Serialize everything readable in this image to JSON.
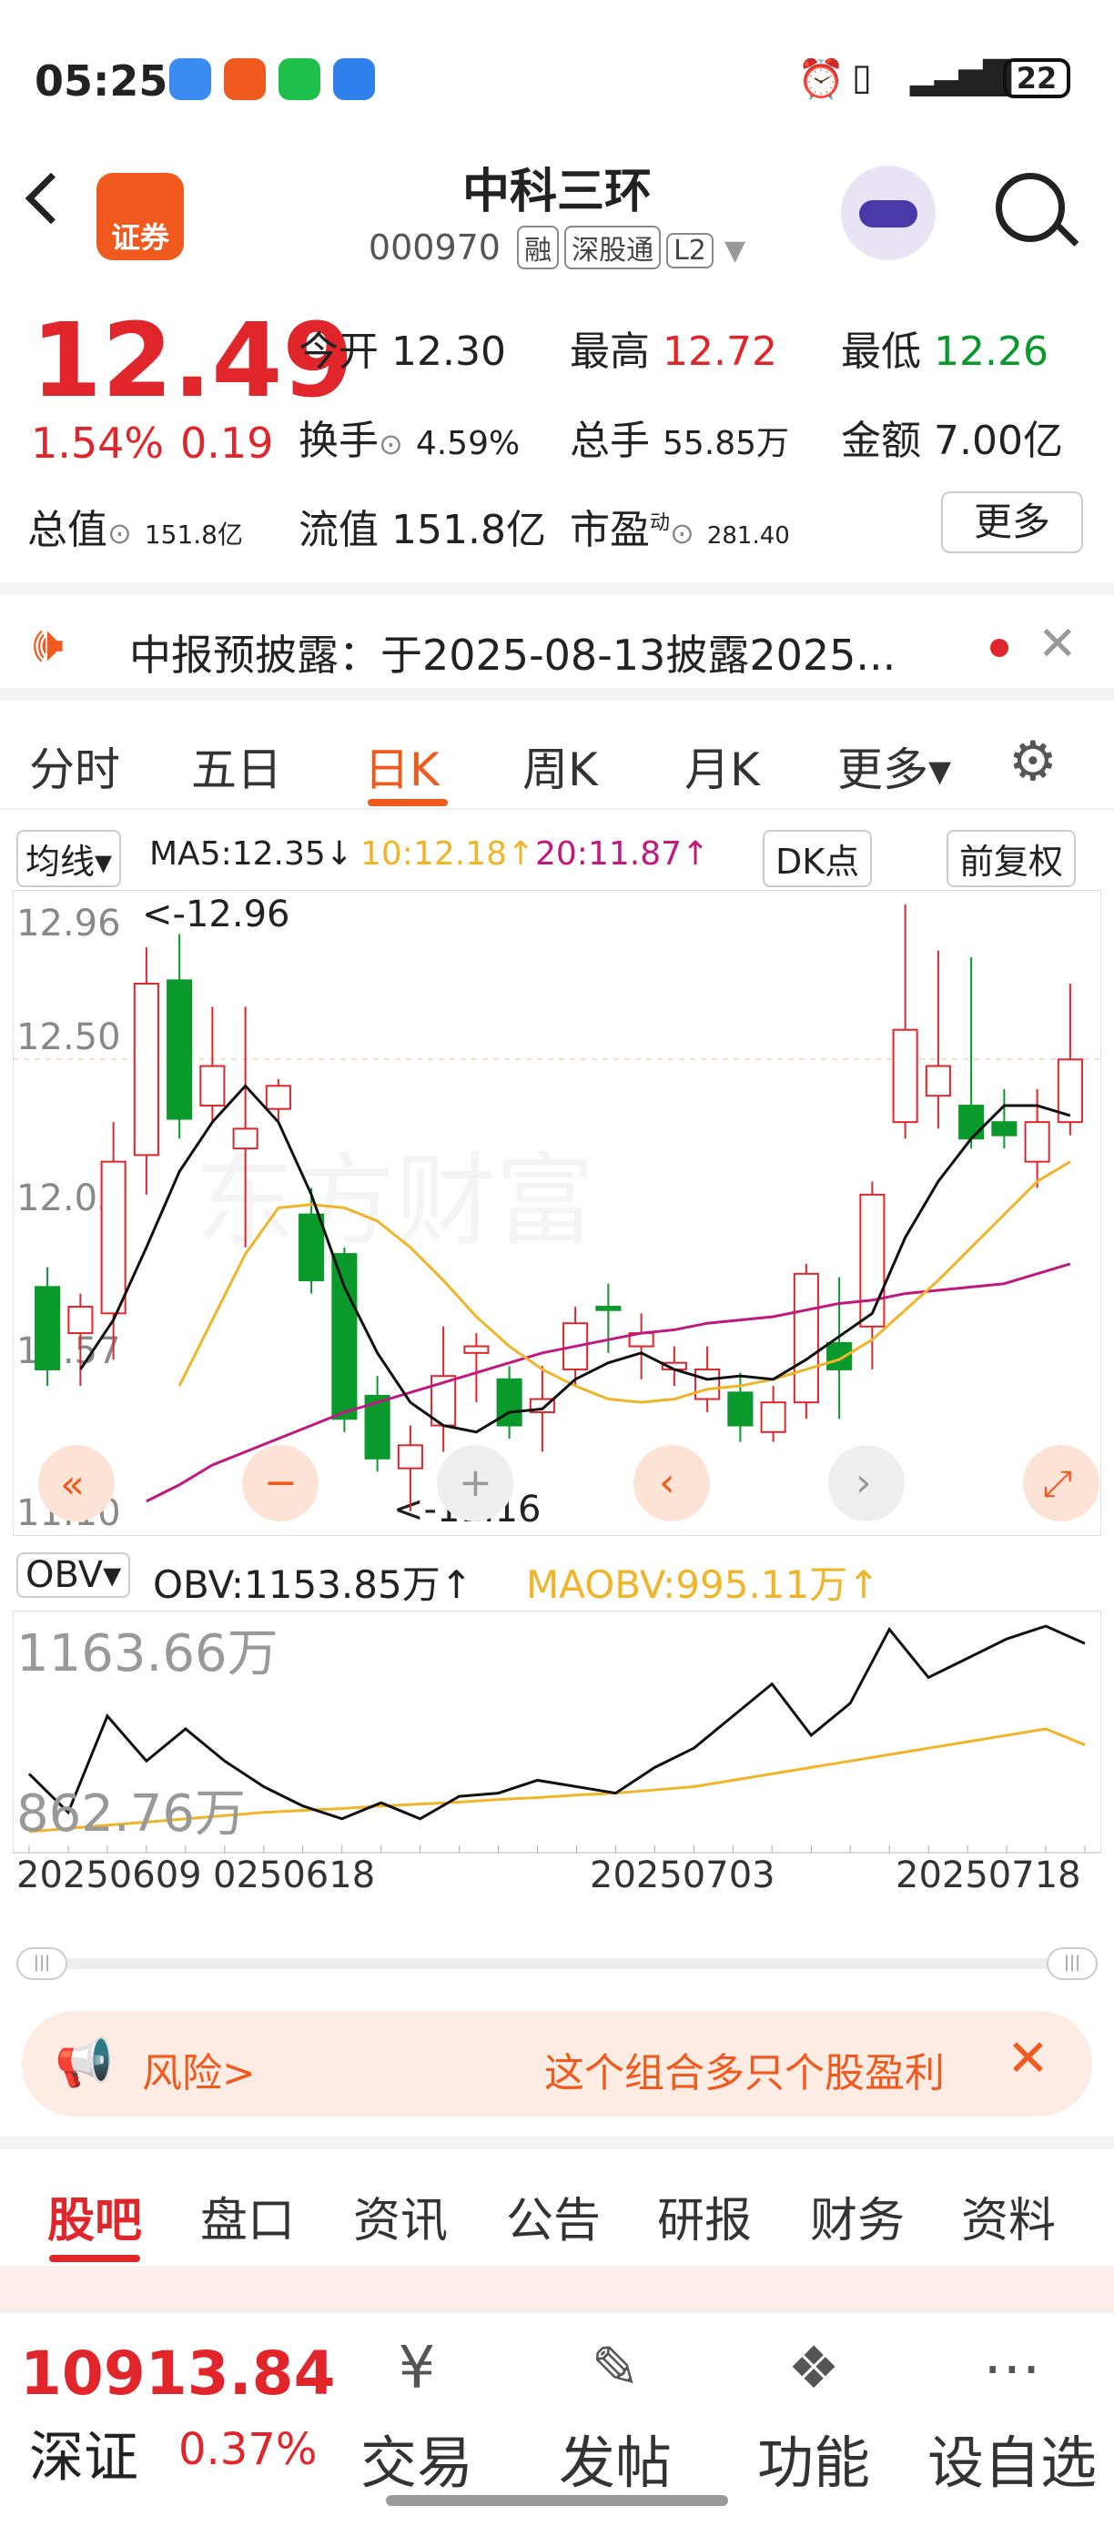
{
  "status": {
    "time": "05:25",
    "battery": "22"
  },
  "header": {
    "logo_label": "证券",
    "title": "中科三环",
    "code": "000970",
    "tags": [
      "融",
      "深股通",
      "L2"
    ]
  },
  "quote": {
    "price": "12.49",
    "change_pct": "1.54%",
    "change": "0.19",
    "open_label": "今开",
    "open": "12.30",
    "high_label": "最高",
    "high": "12.72",
    "low_label": "最低",
    "low": "12.26",
    "turnover_label": "换手",
    "turnover": "4.59%",
    "volume_label": "总手",
    "volume": "55.85万",
    "amount_label": "金额",
    "amount": "7.00亿",
    "mcap_label": "总值",
    "mcap": "151.8亿",
    "float_label": "流值",
    "float": "151.8亿",
    "pe_label": "市盈",
    "pe_sup": "动",
    "pe": "281.40",
    "more": "更多"
  },
  "notice": {
    "text": "中报预披露：于2025-08-13披露2025..."
  },
  "tabs": [
    {
      "label": "分时"
    },
    {
      "label": "五日"
    },
    {
      "label": "日K"
    },
    {
      "label": "周K"
    },
    {
      "label": "月K"
    },
    {
      "label": "更多▾"
    }
  ],
  "kbar": {
    "ma_label": "均线",
    "ma5": "MA5:12.35↓",
    "ma10": "10:12.18↑",
    "ma20": "20:11.87↑",
    "dk": "DK点",
    "adjust": "前复权"
  },
  "chart_data": {
    "type": "candlestick",
    "y_ticks": [
      "12.96",
      "12.50",
      "12.03",
      "11.57",
      "11.10"
    ],
    "max_label": "<-12.96",
    "min_label": "<-11.16",
    "candles": [
      [
        11.8,
        11.55,
        11.86,
        11.5
      ],
      [
        11.66,
        11.74,
        11.78,
        11.5
      ],
      [
        11.72,
        12.18,
        12.3,
        11.58
      ],
      [
        12.2,
        12.72,
        12.83,
        12.08
      ],
      [
        12.73,
        12.31,
        12.87,
        12.25
      ],
      [
        12.35,
        12.47,
        12.65,
        12.3
      ],
      [
        12.22,
        12.28,
        12.65,
        11.92
      ],
      [
        12.34,
        12.41,
        12.43,
        12.3
      ],
      [
        12.02,
        11.82,
        12.1,
        11.78
      ],
      [
        11.9,
        11.4,
        11.92,
        11.36
      ],
      [
        11.47,
        11.28,
        11.53,
        11.24
      ],
      [
        11.25,
        11.32,
        11.38,
        11.12
      ],
      [
        11.38,
        11.53,
        11.68,
        11.3
      ],
      [
        11.6,
        11.62,
        11.66,
        11.45
      ],
      [
        11.52,
        11.38,
        11.56,
        11.34
      ],
      [
        11.42,
        11.46,
        11.56,
        11.3
      ],
      [
        11.55,
        11.69,
        11.74,
        11.5
      ],
      [
        11.74,
        11.73,
        11.81,
        11.6
      ],
      [
        11.62,
        11.66,
        11.72,
        11.52
      ],
      [
        11.55,
        11.57,
        11.62,
        11.5
      ],
      [
        11.46,
        11.55,
        11.62,
        11.42
      ],
      [
        11.48,
        11.38,
        11.54,
        11.33
      ],
      [
        11.36,
        11.45,
        11.5,
        11.33
      ],
      [
        11.45,
        11.84,
        11.87,
        11.4
      ],
      [
        11.63,
        11.55,
        11.83,
        11.4
      ],
      [
        11.68,
        12.08,
        12.12,
        11.55
      ],
      [
        12.3,
        12.58,
        12.96,
        12.25
      ],
      [
        12.38,
        12.47,
        12.82,
        12.28
      ],
      [
        12.35,
        12.25,
        12.8,
        12.22
      ],
      [
        12.3,
        12.26,
        12.4,
        12.22
      ],
      [
        12.18,
        12.3,
        12.4,
        12.1
      ],
      [
        12.3,
        12.49,
        12.72,
        12.26
      ]
    ],
    "ma5": [
      11.55,
      11.7,
      11.92,
      12.15,
      12.3,
      12.41,
      12.3,
      12.08,
      11.8,
      11.6,
      11.45,
      11.38,
      11.36,
      11.42,
      11.43,
      11.52,
      11.57,
      11.6,
      11.55,
      11.52,
      11.53,
      11.52,
      11.58,
      11.65,
      11.72,
      11.95,
      12.12,
      12.25,
      12.35,
      12.35,
      12.32
    ],
    "ma10": [
      null,
      null,
      11.5,
      11.7,
      11.9,
      12.04,
      12.05,
      12.04,
      12.0,
      11.92,
      11.82,
      11.71,
      11.62,
      11.55,
      11.5,
      11.46,
      11.45,
      11.46,
      11.49,
      11.5,
      11.52,
      11.55,
      11.58,
      11.64,
      11.73,
      11.82,
      11.92,
      12.02,
      12.12,
      12.18
    ],
    "ma20": [
      11.15,
      11.2,
      11.26,
      11.3,
      11.34,
      11.38,
      11.42,
      11.45,
      11.48,
      11.51,
      11.54,
      11.57,
      11.6,
      11.62,
      11.64,
      11.66,
      11.67,
      11.69,
      11.7,
      11.71,
      11.73,
      11.75,
      11.76,
      11.78,
      11.79,
      11.8,
      11.81,
      11.84,
      11.87
    ]
  },
  "obv": {
    "label": "OBV",
    "obv": "OBV:1153.85万↑",
    "maobv": "MAOBV:995.11万↑",
    "top": "1163.66万",
    "bottom": "862.76万"
  },
  "obv_data": {
    "obv": [
      950,
      890,
      1040,
      970,
      1020,
      970,
      930,
      900,
      880,
      905,
      880,
      915,
      920,
      940,
      930,
      920,
      960,
      990,
      1040,
      1090,
      1010,
      1060,
      1175,
      1100,
      1130,
      1160,
      1180,
      1153
    ],
    "maobv": [
      860,
      865,
      870,
      875,
      880,
      885,
      890,
      893,
      896,
      900,
      903,
      906,
      910,
      913,
      917,
      920,
      925,
      930,
      940,
      950,
      960,
      970,
      980,
      990,
      1000,
      1010,
      1020,
      995.11
    ]
  },
  "dates": [
    "20250609",
    "0250618",
    "20250703",
    "20250718"
  ],
  "banner": {
    "left": "风险>",
    "right": "这个组合多只个股盈利"
  },
  "bottom_tabs": [
    {
      "label": "股吧"
    },
    {
      "label": "盘口"
    },
    {
      "label": "资讯"
    },
    {
      "label": "公告"
    },
    {
      "label": "研报"
    },
    {
      "label": "财务"
    },
    {
      "label": "资料"
    }
  ],
  "footer": {
    "index_value": "10913.84",
    "index_name": "深证",
    "index_pct": "0.37%",
    "items": [
      {
        "label": "交易",
        "icon": "¥"
      },
      {
        "label": "发帖",
        "icon": "✎"
      },
      {
        "label": "功能",
        "icon": "❖"
      },
      {
        "label": "设自选",
        "icon": "⋯"
      }
    ]
  }
}
